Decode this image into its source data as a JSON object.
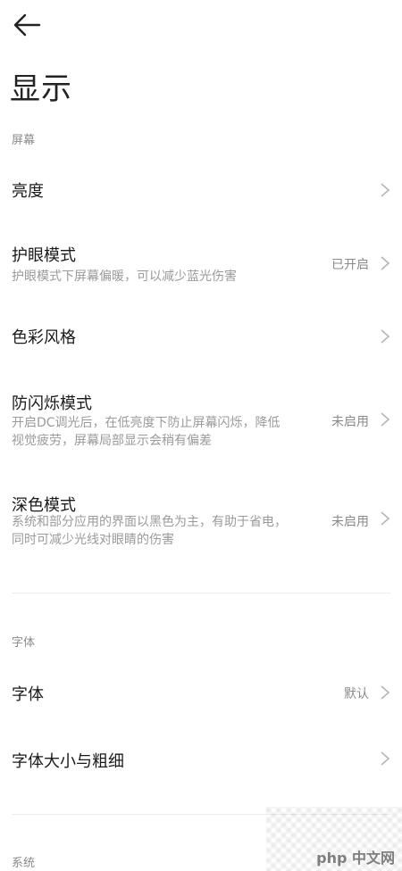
{
  "header": {
    "back_icon": "arrow-left-icon",
    "title": "显示"
  },
  "sections": {
    "screen": {
      "label": "屏幕",
      "items": [
        {
          "title": "亮度",
          "subtitle": "",
          "value": ""
        },
        {
          "title": "护眼模式",
          "subtitle": "护眼模式下屏幕偏暖，可以减少蓝光伤害",
          "value": "已开启"
        },
        {
          "title": "色彩风格",
          "subtitle": "",
          "value": ""
        },
        {
          "title": "防闪烁模式",
          "subtitle_line1": "开启DC调光后，在低亮度下防止屏幕闪烁，降低",
          "subtitle_line2": "视觉疲劳，屏幕局部显示会稍有偏差",
          "value": "未启用"
        },
        {
          "title": "深色模式",
          "subtitle_line1": "系统和部分应用的界面以黑色为主，有助于省电，",
          "subtitle_line2": "同时可减少光线对眼睛的伤害",
          "value": "未启用"
        }
      ]
    },
    "font": {
      "label": "字体",
      "items": [
        {
          "title": "字体",
          "value": "默认"
        },
        {
          "title": "字体大小与粗细",
          "value": ""
        }
      ]
    },
    "system": {
      "label": "系统"
    }
  },
  "watermark": {
    "text": "php 中文网"
  },
  "icons": {
    "chevron": "chevron-right-icon"
  }
}
